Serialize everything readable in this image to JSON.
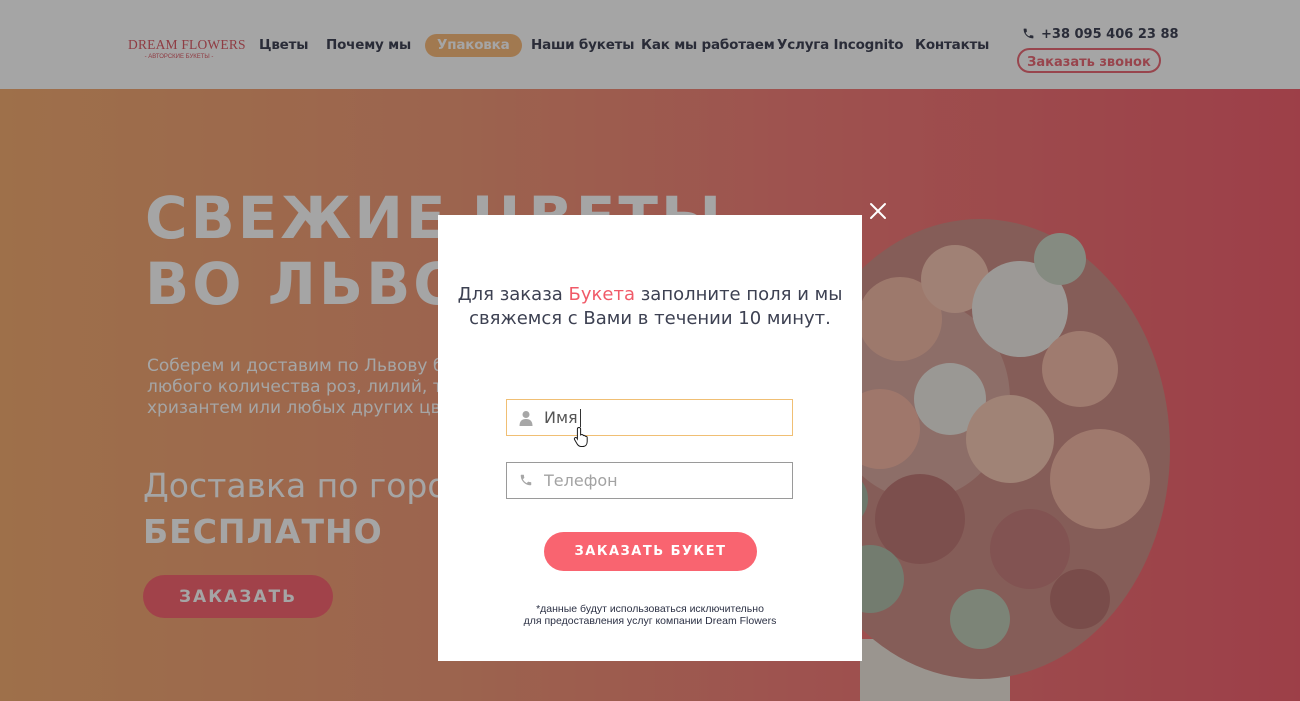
{
  "colors": {
    "brand": "#d94a57",
    "accent": "#f96470",
    "nav_active": "#f8b36d",
    "hero_gradient_start": "#f3a463",
    "hero_gradient_end": "#f15060"
  },
  "header": {
    "logo": {
      "title": "DREAM FLOWERS",
      "subtitle": "- АВТОРСКИЕ БУКЕТЫ -"
    },
    "nav": [
      {
        "label": "Цветы"
      },
      {
        "label": "Почему мы"
      },
      {
        "label": "Упаковка",
        "active": true
      },
      {
        "label": "Наши букеты"
      },
      {
        "label": "Как мы работаем"
      },
      {
        "label": "Услуга Incognito"
      },
      {
        "label": "Контакты"
      }
    ],
    "phone": {
      "icon": "phone-icon",
      "number": "+38 095 406 23 88"
    },
    "callback_label": "Заказать звонок"
  },
  "hero": {
    "title": "СВЕЖИЕ ЦВЕТЫ\nВО ЛЬВОВЕ",
    "description": "Соберем и доставим по Львову букет из любого количества роз, лилий, тюльпанов, хризантем или любых других цветов.",
    "delivery_line": "Доставка по городу",
    "delivery_free": "БЕСПЛАТНО",
    "order_label": "ЗАКАЗАТЬ"
  },
  "modal": {
    "close_icon": "close-icon",
    "heading_before": "Для заказа ",
    "heading_accent": "Букета",
    "heading_after": " заполните поля и мы свяжемся с Вами в течении 10 минут.",
    "name_field": {
      "icon": "user-icon",
      "placeholder": "Имя",
      "value": ""
    },
    "phone_field": {
      "icon": "phone-icon",
      "placeholder": "Телефон",
      "value": ""
    },
    "submit_label": "ЗАКАЗАТЬ БУКЕТ",
    "disclaimer_line1": "*данные будут использоваться исключительно",
    "disclaimer_line2": "для предоставления услуг компании Dream Flowers"
  },
  "cursor": {
    "icon": "hand-pointer-icon"
  }
}
